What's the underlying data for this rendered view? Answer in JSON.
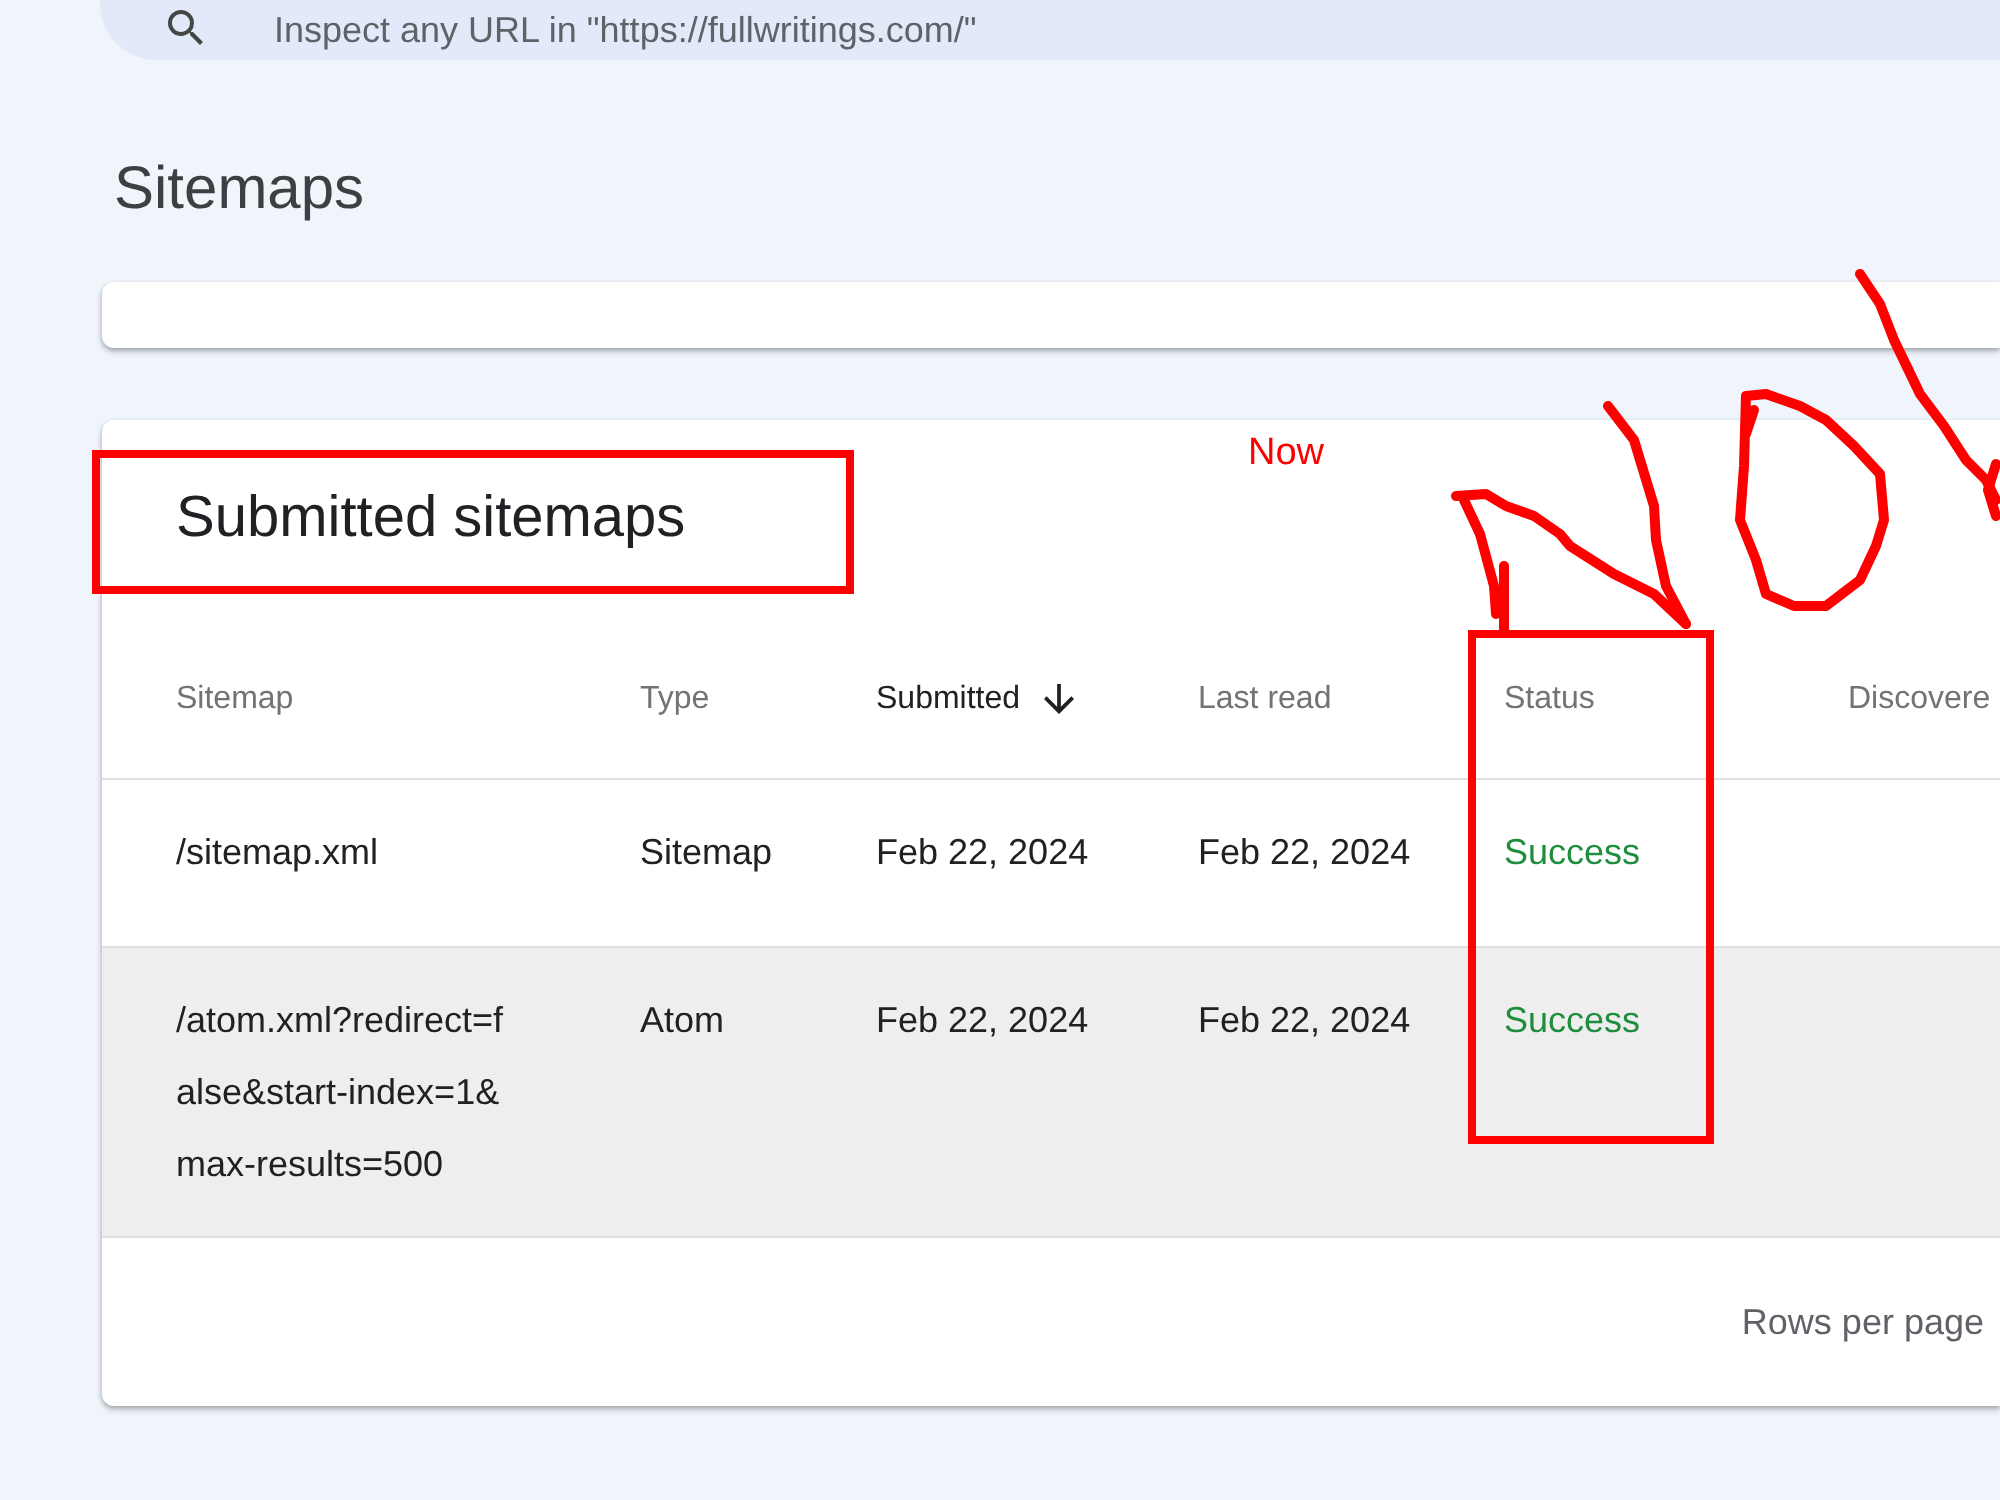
{
  "search": {
    "placeholder": "Inspect any URL in \"https://fullwritings.com/\""
  },
  "page_title": "Sitemaps",
  "submitted_sitemaps": {
    "title": "Submitted sitemaps",
    "columns": [
      {
        "label": "Sitemap",
        "sorted": false
      },
      {
        "label": "Type",
        "sorted": false
      },
      {
        "label": "Submitted",
        "sorted": true
      },
      {
        "label": "Last read",
        "sorted": false
      },
      {
        "label": "Status",
        "sorted": false
      },
      {
        "label": "Discovere",
        "sorted": false
      }
    ],
    "rows": [
      {
        "highlighted": false,
        "sitemap": "/sitemap.xml",
        "type": "Sitemap",
        "submitted": "Feb 22, 2024",
        "last_read": "Feb 22, 2024",
        "status": "Success"
      },
      {
        "highlighted": true,
        "sitemap": "/atom.xml?redirect=false&start-index=1&max-results=500",
        "type": "Atom",
        "submitted": "Feb 22, 2024",
        "last_read": "Feb 22, 2024",
        "status": "Success"
      }
    ],
    "rows_per_page_label": "Rows per page"
  },
  "annotations": {
    "title_outline": true,
    "status_column_outline": true,
    "note": "Now",
    "scribble": true
  }
}
